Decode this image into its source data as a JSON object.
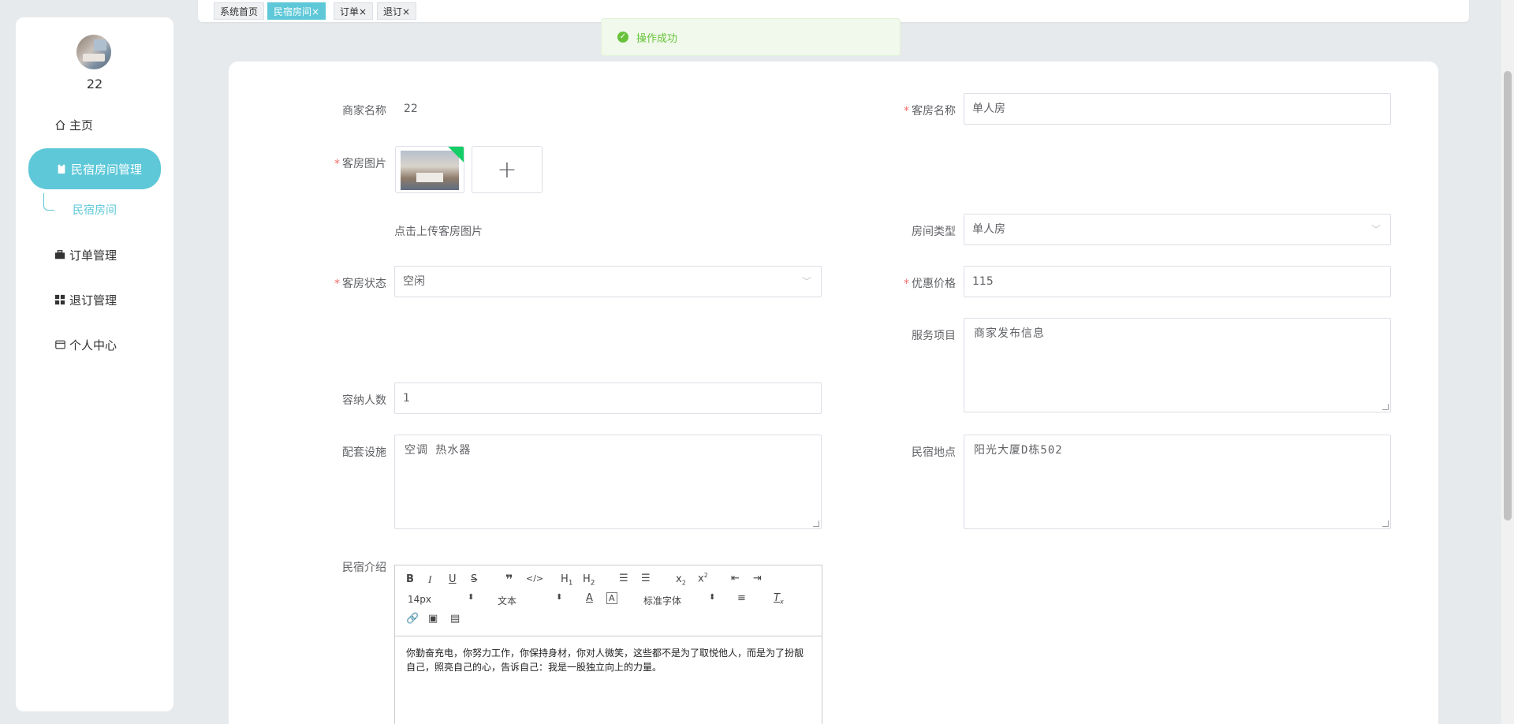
{
  "sidebar": {
    "username": "22",
    "menu": [
      {
        "label": "主页",
        "icon": "home-icon"
      },
      {
        "label": "民宿房间管理",
        "icon": "clipboard-icon"
      },
      {
        "label": "订单管理",
        "icon": "briefcase-icon"
      },
      {
        "label": "退订管理",
        "icon": "grid-icon"
      },
      {
        "label": "个人中心",
        "icon": "card-icon"
      }
    ],
    "submenu": {
      "label": "民宿房间"
    }
  },
  "tabs": [
    {
      "label": "系统首页"
    },
    {
      "label": "民宿房间×"
    },
    {
      "label": "订单×"
    },
    {
      "label": "退订×"
    }
  ],
  "toast": {
    "message": "操作成功"
  },
  "form": {
    "merchant_name_label": "商家名称",
    "merchant_name_value": "22",
    "room_name_label": "客房名称",
    "room_name_value": "单人房",
    "room_image_label": "客房图片",
    "upload_hint": "点击上传客房图片",
    "room_type_label": "房间类型",
    "room_type_value": "单人房",
    "room_status_label": "客房状态",
    "room_status_value": "空闲",
    "price_label": "优惠价格",
    "price_value": "115",
    "services_label": "服务项目",
    "services_value": "商家发布信息",
    "capacity_label": "容纳人数",
    "capacity_value": "1",
    "facilities_label": "配套设施",
    "facilities_value": "空调 热水器",
    "location_label": "民宿地点",
    "location_value": "阳光大厦D栋502",
    "intro_label": "民宿介绍",
    "required_mark": "*"
  },
  "editor": {
    "font_size": "14px",
    "text_type": "文本",
    "font_family": "标准字体",
    "content": "你勤奋充电，你努力工作，你保持身材，你对人微笑，这些都不是为了取悦他人，而是为了扮靓自己，照亮自己的心，告诉自己：我是一股独立向上的力量。"
  }
}
